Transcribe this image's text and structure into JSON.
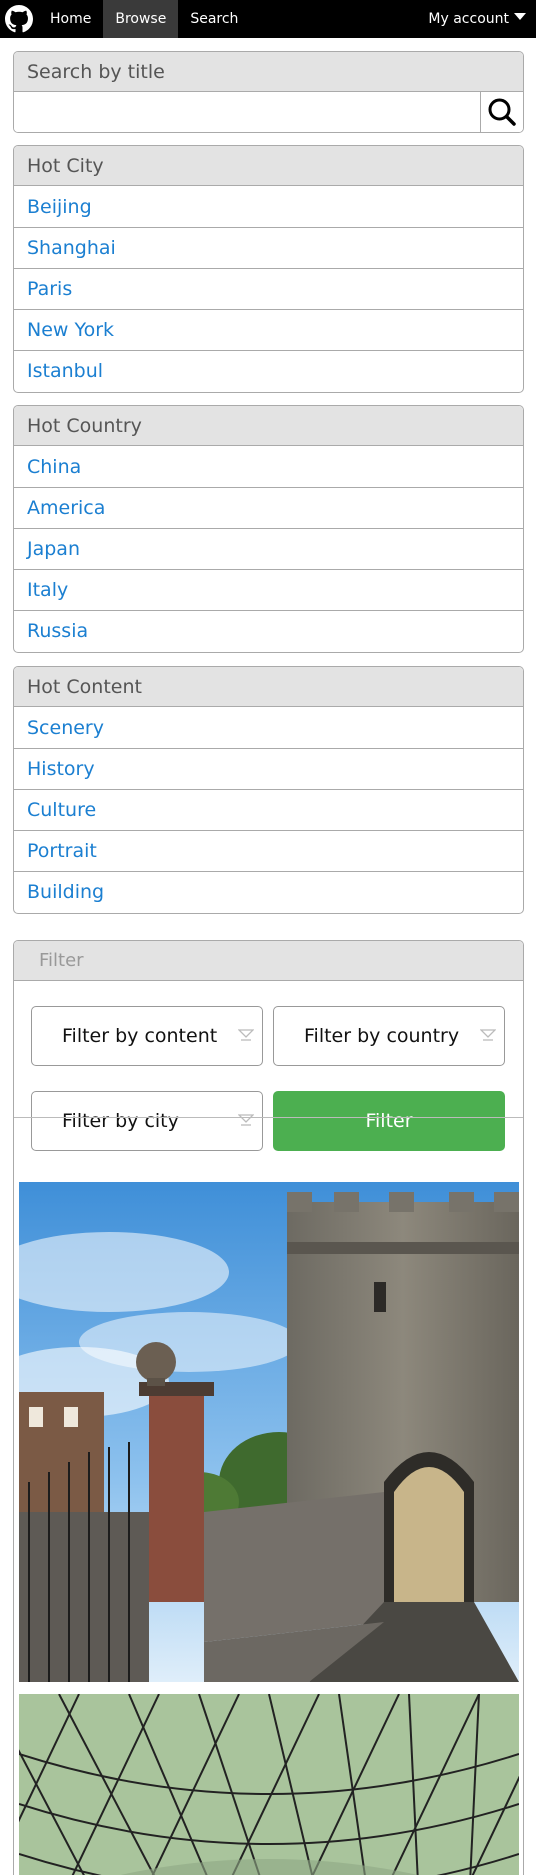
{
  "nav": {
    "logo_icon": "github-octocat-icon",
    "links": [
      "Home",
      "Browse",
      "Search"
    ],
    "active": "Browse",
    "account_label": "My account"
  },
  "search": {
    "title": "Search by title",
    "value": "",
    "icon": "search-icon"
  },
  "hot_city": {
    "title": "Hot City",
    "items": [
      "Beijing",
      "Shanghai",
      "Paris",
      "New York",
      "Istanbul"
    ]
  },
  "hot_country": {
    "title": "Hot Country",
    "items": [
      "China",
      "America",
      "Japan",
      "Italy",
      "Russia"
    ]
  },
  "hot_content": {
    "title": "Hot Content",
    "items": [
      "Scenery",
      "History",
      "Culture",
      "Portrait",
      "Building"
    ]
  },
  "filter": {
    "title": "Filter",
    "content_select": "Filter by content",
    "country_select": "Filter by country",
    "city_select": "Filter by city",
    "button_label": "Filter"
  },
  "colors": {
    "link": "#1b7fd1",
    "filter_button": "#4caf50",
    "navbar": "#000000",
    "panel_heading": "#e3e3e3"
  }
}
